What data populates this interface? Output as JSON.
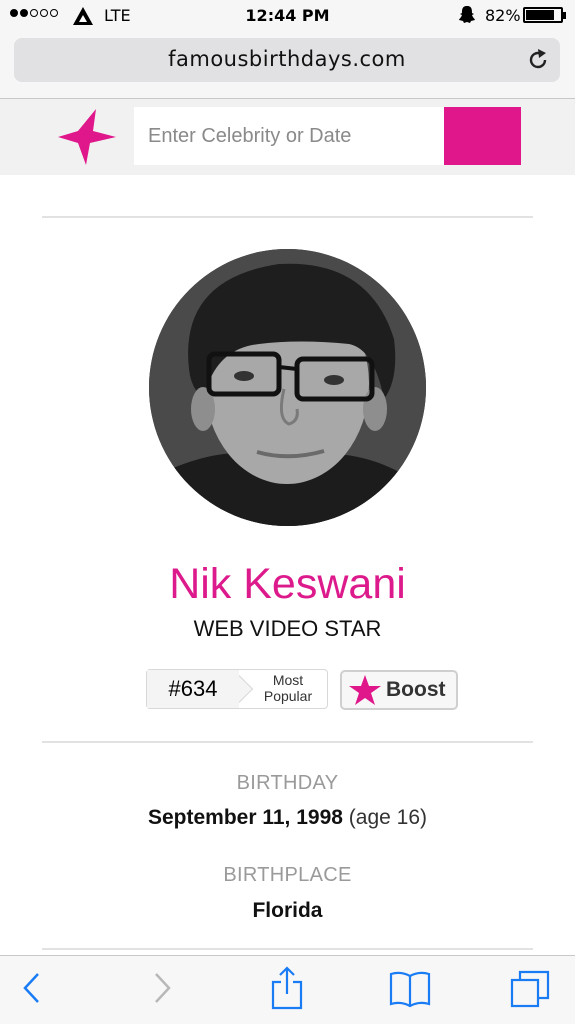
{
  "status_bar": {
    "signal_filled": 2,
    "signal_total": 5,
    "network": "LTE",
    "time": "12:44 PM",
    "battery_percent": "82%",
    "battery_level": 0.82
  },
  "browser": {
    "url": "famousbirthdays.com",
    "reload_icon": "reload-icon"
  },
  "site": {
    "logo_icon": "star-logo-icon",
    "search_placeholder": "Enter Celebrity or Date",
    "brand_color": "#e0168b"
  },
  "profile": {
    "name": "Nik Keswani",
    "profession": "WEB VIDEO STAR",
    "rank": "#634",
    "rank_label_line1": "Most",
    "rank_label_line2": "Popular",
    "boost_label": "Boost",
    "birthday_label": "BIRTHDAY",
    "birthday_value": "September 11, 1998",
    "age_text": "(age 16)",
    "birthplace_label": "BIRTHPLACE",
    "birthplace_value": "Florida"
  },
  "toolbar": {
    "items": [
      "back-icon",
      "forward-icon",
      "share-icon",
      "bookmarks-icon",
      "tabs-icon"
    ]
  }
}
